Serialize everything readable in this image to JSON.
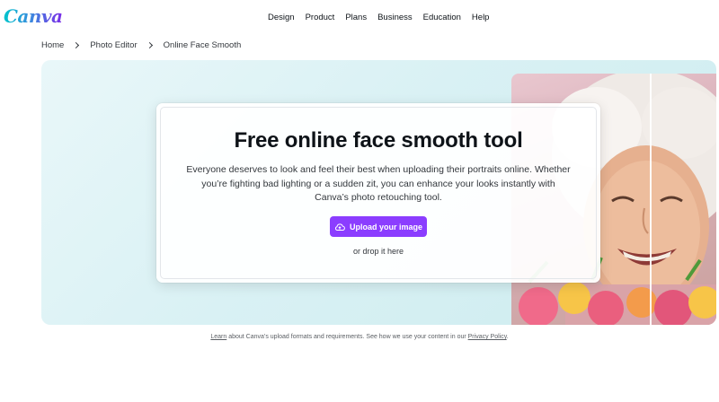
{
  "brand": {
    "logo_text": "Canva"
  },
  "nav": {
    "items": [
      {
        "label": "Design"
      },
      {
        "label": "Product"
      },
      {
        "label": "Plans"
      },
      {
        "label": "Business"
      },
      {
        "label": "Education"
      },
      {
        "label": "Help"
      }
    ]
  },
  "breadcrumb": {
    "items": [
      {
        "label": "Home"
      },
      {
        "label": "Photo Editor"
      },
      {
        "label": "Online Face Smooth"
      }
    ]
  },
  "hero": {
    "title": "Free online face smooth tool",
    "description": "Everyone deserves to look and feel their best when uploading their portraits online. Whether you’re fighting bad lighting or a sudden zit, you can enhance your looks instantly with Canva’s photo retouching tool.",
    "upload_label": "Upload your image",
    "upload_icon": "cloud-upload-icon",
    "drop_text": "or drop it here",
    "accent_color": "#8b3dff"
  },
  "footnote": {
    "learn_link": "Learn",
    "middle_text": " about Canva’s upload formats and requirements. See how we use your content in our ",
    "privacy_link": "Privacy Policy",
    "end_text": "."
  }
}
